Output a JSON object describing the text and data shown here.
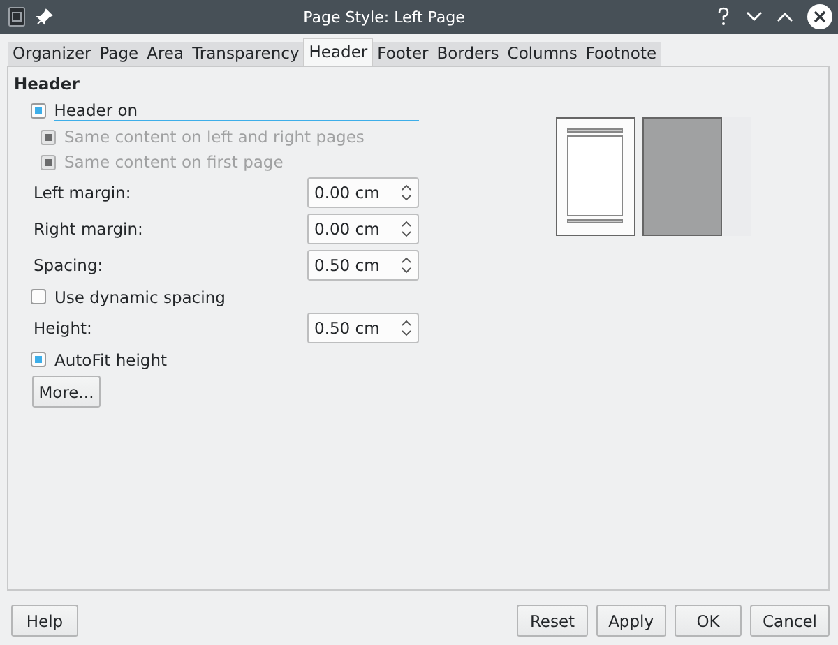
{
  "window": {
    "title": "Page Style: Left Page"
  },
  "tabs": [
    {
      "label": "Organizer",
      "selected": false
    },
    {
      "label": "Page",
      "selected": false
    },
    {
      "label": "Area",
      "selected": false
    },
    {
      "label": "Transparency",
      "selected": false
    },
    {
      "label": "Header",
      "selected": true
    },
    {
      "label": "Footer",
      "selected": false
    },
    {
      "label": "Borders",
      "selected": false
    },
    {
      "label": "Columns",
      "selected": false
    },
    {
      "label": "Footnote",
      "selected": false
    }
  ],
  "section_title": "Header",
  "rows": [
    {
      "kind": "check",
      "label": "Header on",
      "checked": true,
      "disabled": false,
      "focused": true
    },
    {
      "kind": "check",
      "label": "Same content on left and right pages",
      "checked": true,
      "disabled": true,
      "indent": true
    },
    {
      "kind": "check",
      "label": "Same content on first page",
      "checked": true,
      "disabled": true,
      "indent": true
    },
    {
      "kind": "spin",
      "label": "Left margin:",
      "value": "0.00 cm"
    },
    {
      "kind": "spin",
      "label": "Right margin:",
      "value": "0.00 cm"
    },
    {
      "kind": "spin",
      "label": "Spacing:",
      "value": "0.50 cm"
    },
    {
      "kind": "check",
      "label": "Use dynamic spacing",
      "checked": false,
      "disabled": false
    },
    {
      "kind": "spin",
      "label": "Height:",
      "value": "0.50 cm"
    },
    {
      "kind": "check",
      "label": "AutoFit height",
      "checked": true,
      "disabled": false
    },
    {
      "kind": "button",
      "label": "More..."
    }
  ],
  "buttons_left": [
    "Help"
  ],
  "buttons_right": [
    "Reset",
    "Apply",
    "OK",
    "Cancel"
  ]
}
